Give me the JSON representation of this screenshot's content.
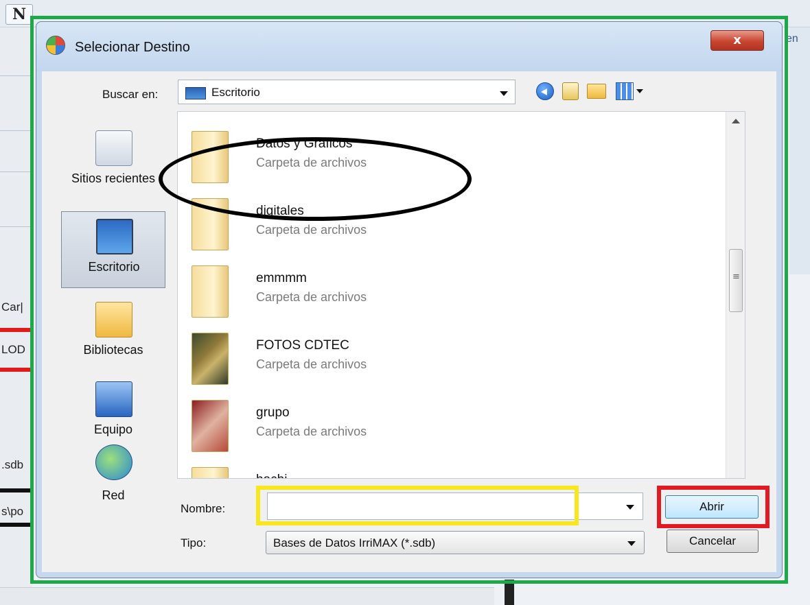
{
  "background": {
    "logo_letter": "N",
    "fragments": [
      "Car|",
      "LOD",
      ".sdb",
      "s\\po"
    ],
    "right_text": "en"
  },
  "dialog": {
    "title": "Selecionar Destino",
    "close_label": "x",
    "look_in_label": "Buscar en:",
    "look_in_value": "Escritorio",
    "places": [
      {
        "label": "Sitios recientes",
        "icon": "recent-places-icon"
      },
      {
        "label": "Escritorio",
        "icon": "desktop-icon",
        "selected": true
      },
      {
        "label": "Bibliotecas",
        "icon": "libraries-icon"
      },
      {
        "label": "Equipo",
        "icon": "computer-icon"
      },
      {
        "label": "Red",
        "icon": "network-icon"
      }
    ],
    "files": [
      {
        "name": "Datos y Graficos",
        "type": "Carpeta de archivos"
      },
      {
        "name": "digitales",
        "type": "Carpeta de archivos"
      },
      {
        "name": "emmmm",
        "type": "Carpeta de archivos"
      },
      {
        "name": "FOTOS CDTEC",
        "type": "Carpeta de archivos"
      },
      {
        "name": "grupo",
        "type": "Carpeta de archivos"
      },
      {
        "name": "hachi",
        "type": ""
      }
    ],
    "file_name_label": "Nombre:",
    "file_name_value": "",
    "file_type_label": "Tipo:",
    "file_type_value": "Bases de Datos IrriMAX (*.sdb)",
    "open_label": "Abrir",
    "cancel_label": "Cancelar"
  },
  "annotation_colors": {
    "frame": "#1fa84a",
    "ellipse": "#000000",
    "name_box": "#f8e71c",
    "open_box": "#e01b24"
  }
}
